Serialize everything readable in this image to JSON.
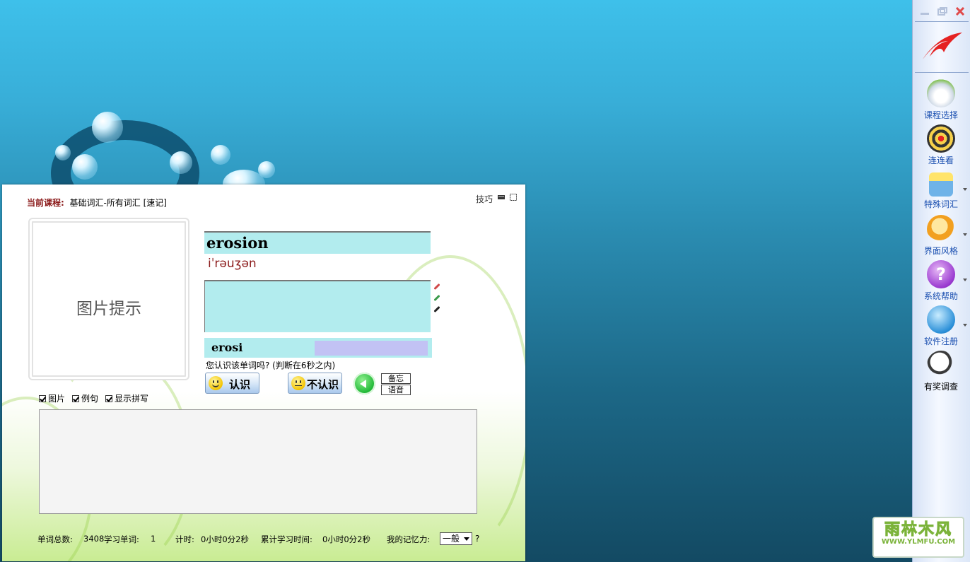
{
  "main": {
    "course_label": "当前课程:",
    "course_value": "基础词汇-所有词汇 [速记]",
    "tips_label": "技巧",
    "picture_hint": "图片提示",
    "word": "erosion",
    "phonetic": "iˈrəuʒən",
    "spelling_input": "erosi",
    "question": "您认识该单词吗?  (判断在6秒之内)",
    "know_button": "认识",
    "dont_know_button": "不认识",
    "memo_button": "备忘",
    "voice_button": "语音",
    "checkboxes": [
      {
        "label": "图片",
        "checked": true
      },
      {
        "label": "例句",
        "checked": true
      },
      {
        "label": "显示拼写",
        "checked": true
      }
    ],
    "status": {
      "total_words_label": "单词总数:",
      "total_words": "3408",
      "studied_label": "学习单词:",
      "studied": "1",
      "timer_label": "计时:",
      "timer": "0小时0分2秒",
      "cumulative_label": "累计学习时间:",
      "cumulative": "0小时0分2秒",
      "memory_label": "我的记忆力:",
      "memory_value": "一般",
      "help_mark": "?"
    }
  },
  "sidebar": {
    "items": [
      {
        "label": "课程选择",
        "icon": "book-plant-icon"
      },
      {
        "label": "连连看",
        "icon": "dartboard-icon"
      },
      {
        "label": "特殊词汇",
        "icon": "basket-icon"
      },
      {
        "label": "界面风格",
        "icon": "magnifier-tree-icon"
      },
      {
        "label": "系统帮助",
        "icon": "help-icon"
      },
      {
        "label": "软件注册",
        "icon": "globe-icon"
      },
      {
        "label": "有奖调查",
        "icon": "search-icon"
      }
    ]
  },
  "watermark": {
    "big": "雨林木风",
    "small": "WWW.YLMFU.COM"
  },
  "colors": {
    "word_bg": "#b2ecee",
    "course_label": "#8b1a1a",
    "sidebar_text": "#1a4fb0"
  }
}
